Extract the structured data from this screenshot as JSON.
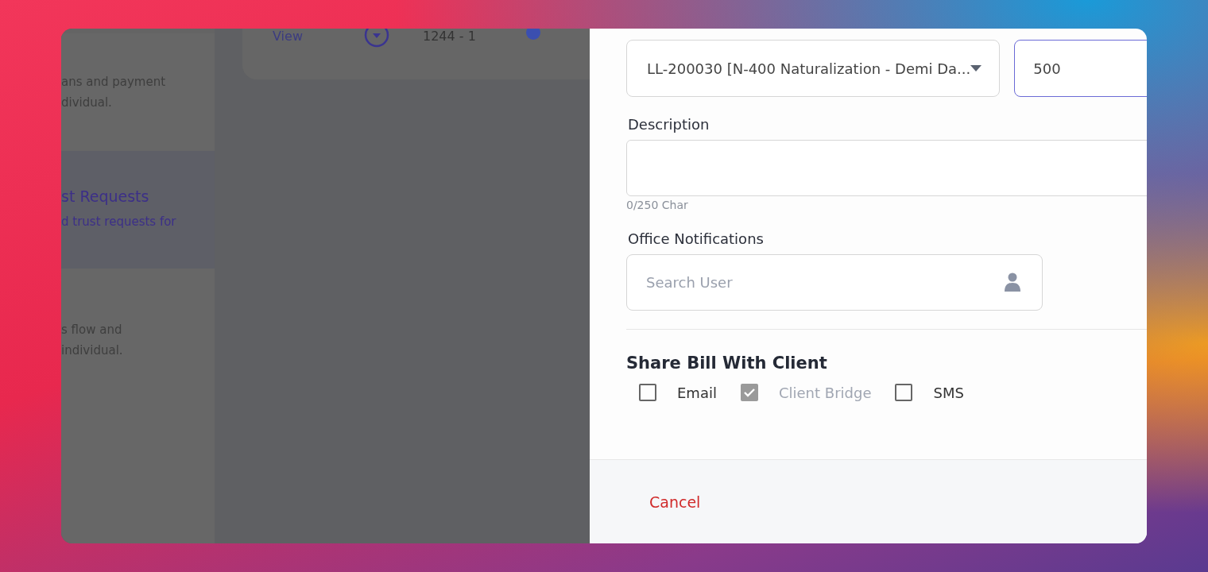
{
  "background_app": {
    "top_card": {
      "link": "View",
      "number": "1244 - 1"
    },
    "side_cards": [
      {
        "lines": [
          "ans and payment",
          "dividual."
        ],
        "selected": false
      },
      {
        "title": "st Requests",
        "lines": [
          "d trust requests for"
        ],
        "selected": true
      },
      {
        "lines": [
          "s flow and",
          "individual."
        ],
        "selected": false
      }
    ]
  },
  "drawer": {
    "matter_select": {
      "value": "LL-200030 [N-400 Naturalization - Demi Da..."
    },
    "amount_field": {
      "value": "500",
      "focused": true
    },
    "description": {
      "label": "Description",
      "counter": "0/250 Char"
    },
    "office_notifications": {
      "label": "Office Notifications",
      "placeholder": "Search User"
    },
    "share": {
      "heading": "Share Bill With Client",
      "options": [
        {
          "label": "Email",
          "checked": false,
          "disabled": false
        },
        {
          "label": "Client Bridge",
          "checked": true,
          "disabled": true
        },
        {
          "label": "SMS",
          "checked": false,
          "disabled": false
        }
      ]
    },
    "footer": {
      "cancel": "Cancel"
    }
  }
}
